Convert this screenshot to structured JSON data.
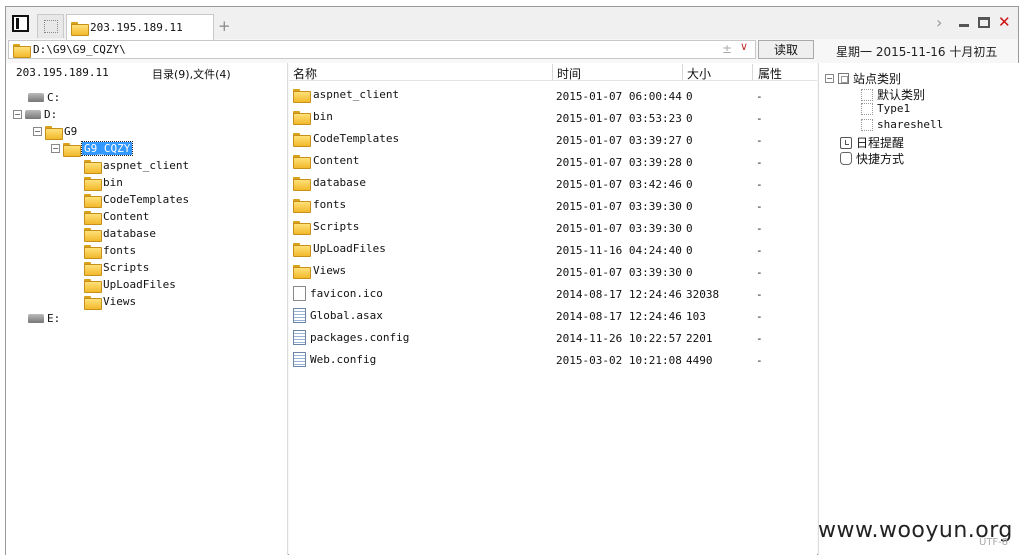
{
  "tab": {
    "title": "203.195.189.11"
  },
  "address": {
    "path": "D:\\G9\\G9_CQZY\\",
    "read_button": "读取"
  },
  "date_label": "星期一 2015-11-16 十月初五",
  "left": {
    "host": "203.195.189.11",
    "summary": "目录(9),文件(4)",
    "drives": [
      {
        "label": "C:"
      },
      {
        "label": "D:"
      },
      {
        "label": "E:"
      }
    ],
    "path_nodes": [
      {
        "label": "G9"
      },
      {
        "label": "G9_CQZY"
      }
    ],
    "subfolders": [
      "aspnet_client",
      "bin",
      "CodeTemplates",
      "Content",
      "database",
      "fonts",
      "Scripts",
      "UpLoadFiles",
      "Views"
    ]
  },
  "columns": {
    "name": "名称",
    "time": "时间",
    "size": "大小",
    "attr": "属性"
  },
  "files": [
    {
      "name": "aspnet_client",
      "time": "2015-01-07 06:00:44",
      "size": "0",
      "attr": "-",
      "icon": "folder-icon"
    },
    {
      "name": "bin",
      "time": "2015-01-07 03:53:23",
      "size": "0",
      "attr": "-",
      "icon": "folder-icon"
    },
    {
      "name": "CodeTemplates",
      "time": "2015-01-07 03:39:27",
      "size": "0",
      "attr": "-",
      "icon": "folder-icon"
    },
    {
      "name": "Content",
      "time": "2015-01-07 03:39:28",
      "size": "0",
      "attr": "-",
      "icon": "folder-icon"
    },
    {
      "name": "database",
      "time": "2015-01-07 03:42:46",
      "size": "0",
      "attr": "-",
      "icon": "folder-icon"
    },
    {
      "name": "fonts",
      "time": "2015-01-07 03:39:30",
      "size": "0",
      "attr": "-",
      "icon": "folder-icon"
    },
    {
      "name": "Scripts",
      "time": "2015-01-07 03:39:30",
      "size": "0",
      "attr": "-",
      "icon": "folder-icon"
    },
    {
      "name": "UpLoadFiles",
      "time": "2015-11-16 04:24:40",
      "size": "0",
      "attr": "-",
      "icon": "folder-icon"
    },
    {
      "name": "Views",
      "time": "2015-01-07 03:39:30",
      "size": "0",
      "attr": "-",
      "icon": "folder-icon"
    },
    {
      "name": "favicon.ico",
      "time": "2014-08-17 12:24:46",
      "size": "32038",
      "attr": "-",
      "icon": "file-icon"
    },
    {
      "name": "Global.asax",
      "time": "2014-08-17 12:24:46",
      "size": "103",
      "attr": "-",
      "icon": "doc-icon"
    },
    {
      "name": "packages.config",
      "time": "2014-11-26 10:22:57",
      "size": "2201",
      "attr": "-",
      "icon": "doc-icon"
    },
    {
      "name": "Web.config",
      "time": "2015-03-02 10:21:08",
      "size": "4490",
      "attr": "-",
      "icon": "doc-icon"
    }
  ],
  "right": {
    "site_category": "站点类别",
    "categories": [
      "默认类别",
      "Type1",
      "shareshell"
    ],
    "schedule": "日程提醒",
    "shortcuts": "快捷方式"
  },
  "watermark": "www.wooyun.org",
  "encoding": "UTF-8"
}
